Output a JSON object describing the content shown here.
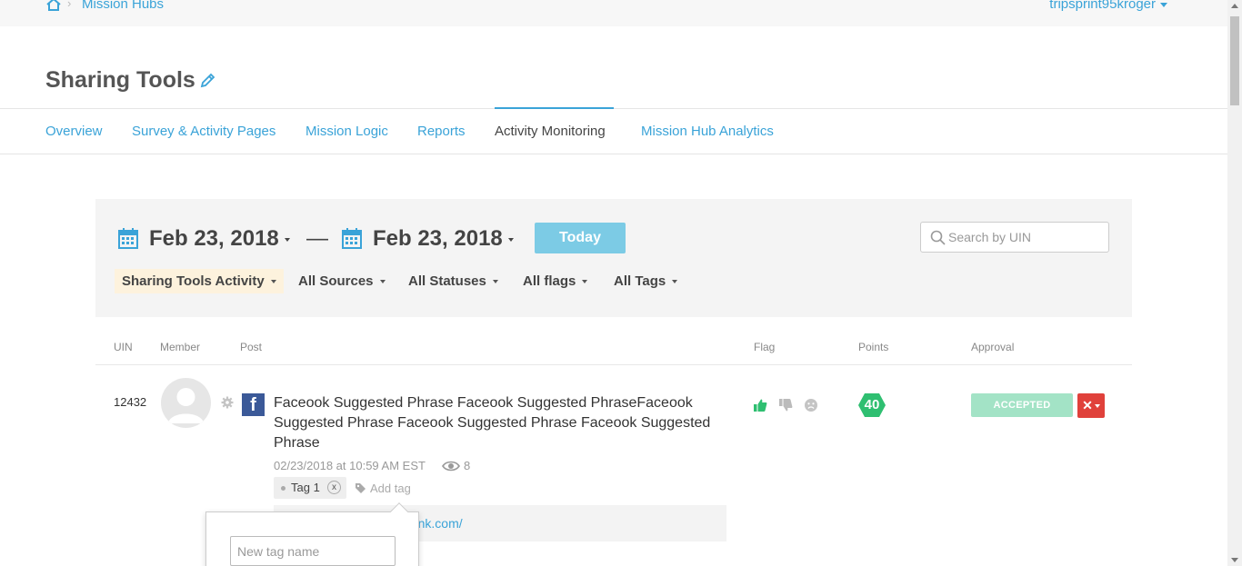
{
  "breadcrumb": {
    "link": "Mission Hubs"
  },
  "user": {
    "name": "tripsprint95kroger"
  },
  "header": {
    "title": "Sharing Tools"
  },
  "tabs": [
    {
      "label": "Overview"
    },
    {
      "label": "Survey & Activity Pages"
    },
    {
      "label": "Mission Logic"
    },
    {
      "label": "Reports"
    },
    {
      "label": "Activity Monitoring",
      "active": true
    },
    {
      "label": "Mission Hub Analytics"
    }
  ],
  "filters": {
    "date_from": "Feb 23, 2018",
    "date_to": "Feb 23, 2018",
    "dash": "—",
    "today_label": "Today",
    "search_placeholder": "Search by UIN",
    "dropdowns": [
      "Sharing Tools Activity",
      "All Sources",
      "All Statuses",
      "All flags",
      "All Tags"
    ]
  },
  "table": {
    "headers": [
      "UIN",
      "Member",
      "Post",
      "Flag",
      "Points",
      "Approval"
    ],
    "rows": [
      {
        "uin": "12432",
        "source_icon": "facebook-icon",
        "post": "Faceook Suggested Phrase Faceook Suggested PhraseFaceook Suggested Phrase Faceook Suggested Phrase Faceook Suggested Phrase",
        "meta": "02/23/2018 at 10:59 AM EST",
        "views": "8",
        "tag": "Tag 1",
        "tag_remove": "x",
        "add_tag_label": "Add tag",
        "link": "http://www.socialmedialink.com/",
        "points": "40",
        "approval": "ACCEPTED",
        "reject_label": "✕"
      }
    ]
  },
  "tag_popover": {
    "placeholder": "New tag name"
  },
  "colors": {
    "accent": "#3aa3d8",
    "success": "#2fbf71",
    "danger": "#e0413b"
  }
}
